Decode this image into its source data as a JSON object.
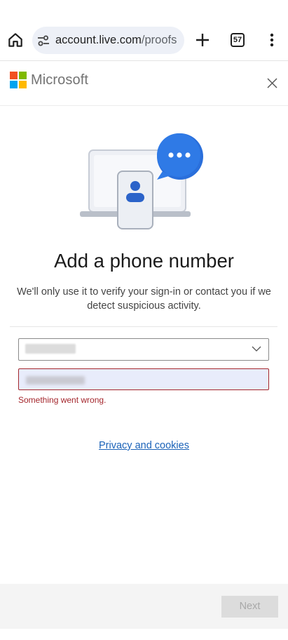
{
  "browser": {
    "url_main": "account.live.com",
    "url_path": "/proofs",
    "tab_count": "57"
  },
  "brand": {
    "wordmark": "Microsoft",
    "logo_colors": [
      "#f25022",
      "#7fba00",
      "#00a4ef",
      "#ffb900"
    ]
  },
  "page": {
    "title": "Add a phone number",
    "subtitle": "We'll only use it to verify your sign-in or contact you if we detect suspicious activity."
  },
  "form": {
    "country_value": "",
    "phone_value": "",
    "error": "Something went wrong."
  },
  "links": {
    "privacy": "Privacy and cookies"
  },
  "footer": {
    "next_label": "Next"
  },
  "colors": {
    "accent": "#1a62b8",
    "error": "#a4262c"
  }
}
